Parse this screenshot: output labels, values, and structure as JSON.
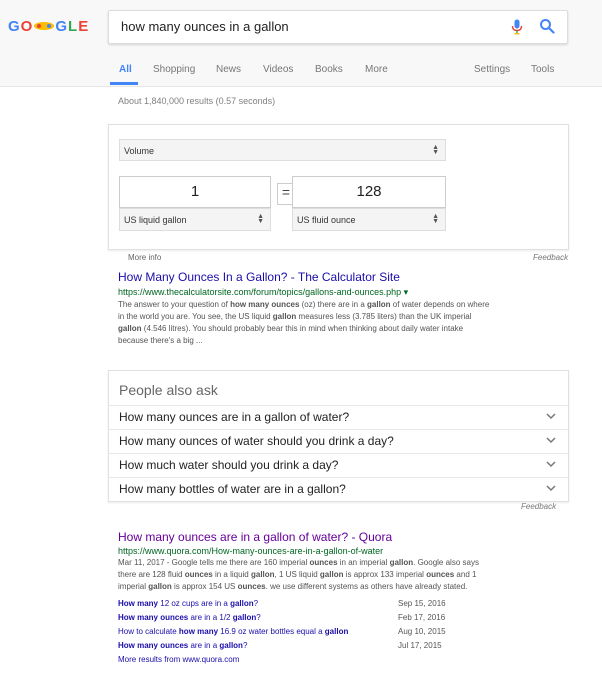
{
  "search": {
    "query": "how many ounces in a gallon"
  },
  "logo": {
    "letters": [
      "G",
      "O",
      "",
      "",
      "G",
      "L",
      "E"
    ],
    "colors": [
      "#4285f4",
      "#ea4335",
      "#fbbc05",
      "#fbbc05",
      "#4285f4",
      "#34a853",
      "#ea4335"
    ]
  },
  "tabs": [
    {
      "label": "All",
      "active": true
    },
    {
      "label": "Shopping"
    },
    {
      "label": "News"
    },
    {
      "label": "Videos"
    },
    {
      "label": "Books"
    },
    {
      "label": "More"
    },
    {
      "label": "Settings"
    },
    {
      "label": "Tools"
    }
  ],
  "stats": "About 1,840,000 results (0.57 seconds)",
  "converter": {
    "category": "Volume",
    "left_value": "1",
    "right_value": "128",
    "equals": "=",
    "left_unit": "US liquid gallon",
    "right_unit": "US fluid ounce",
    "more_info": "More info",
    "feedback": "Feedback"
  },
  "result1": {
    "title": "How Many Ounces In a Gallon? - The Calculator Site",
    "url": "https://www.thecalculatorsite.com/forum/topics/gallons-and-ounces.php",
    "url_arrow": "▾",
    "snippet_lines": [
      "The answer to your question of how many ounces (oz) there are in a gallon of water depends on where",
      "in the world you are. You see, the US liquid gallon measures less (3.785 liters) than the UK imperial",
      "gallon (4.546 litres). You should probably bear this in mind when thinking about daily water intake",
      "because there's a big ..."
    ]
  },
  "people_also_ask": {
    "title": "People also ask",
    "questions": [
      "How many ounces are in a gallon of water?",
      "How many ounces of water should you drink a day?",
      "How much water should you drink a day?",
      "How many bottles of water are in a gallon?"
    ],
    "feedback": "Feedback"
  },
  "result2": {
    "title": "How many ounces are in a gallon of water? - Quora",
    "url": "https://www.quora.com/How-many-ounces-are-in-a-gallon-of-water",
    "snippet_lines": [
      "Mar 11, 2017 - Google tells me there are 160 imperial ounces in an imperial gallon. Google also says",
      "there are 128 fluid ounces in a liquid gallon, 1 US liquid gallon is approx 133 imperial ounces and 1",
      "imperial gallon is approx 154 US ounces. we use different systems as others have already stated."
    ],
    "sitelinks": [
      {
        "label": "How many 12 oz cups are in a gallon?",
        "date": "Sep 15, 2016"
      },
      {
        "label": "How many ounces are in a 1/2 gallon?",
        "date": "Feb 17, 2016"
      },
      {
        "label": "How to calculate how many 16.9 oz water bottles equal a gallon",
        "date": "Aug 10, 2015"
      },
      {
        "label": "How many ounces are in a gallon?",
        "date": "Jul 17, 2015"
      }
    ],
    "more_results": "More results from www.quora.com"
  }
}
